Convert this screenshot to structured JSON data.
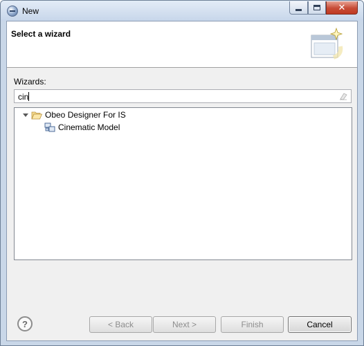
{
  "window": {
    "title": "New",
    "controls": {
      "minimize": "minimize",
      "maximize": "maximize",
      "close": "close"
    }
  },
  "header": {
    "title": "Select a wizard",
    "banner_icon": "wizard-banner-icon"
  },
  "wizards": {
    "label": "Wizards:",
    "filter_value": "cin",
    "tree": [
      {
        "category": "Obeo Designer For IS",
        "icon": "folder-open-icon",
        "expanded": true,
        "items": [
          {
            "label": "Cinematic Model",
            "icon": "model-icon"
          }
        ]
      }
    ]
  },
  "buttons": {
    "help": "?",
    "back": "< Back",
    "next": "Next >",
    "finish": "Finish",
    "cancel": "Cancel"
  }
}
